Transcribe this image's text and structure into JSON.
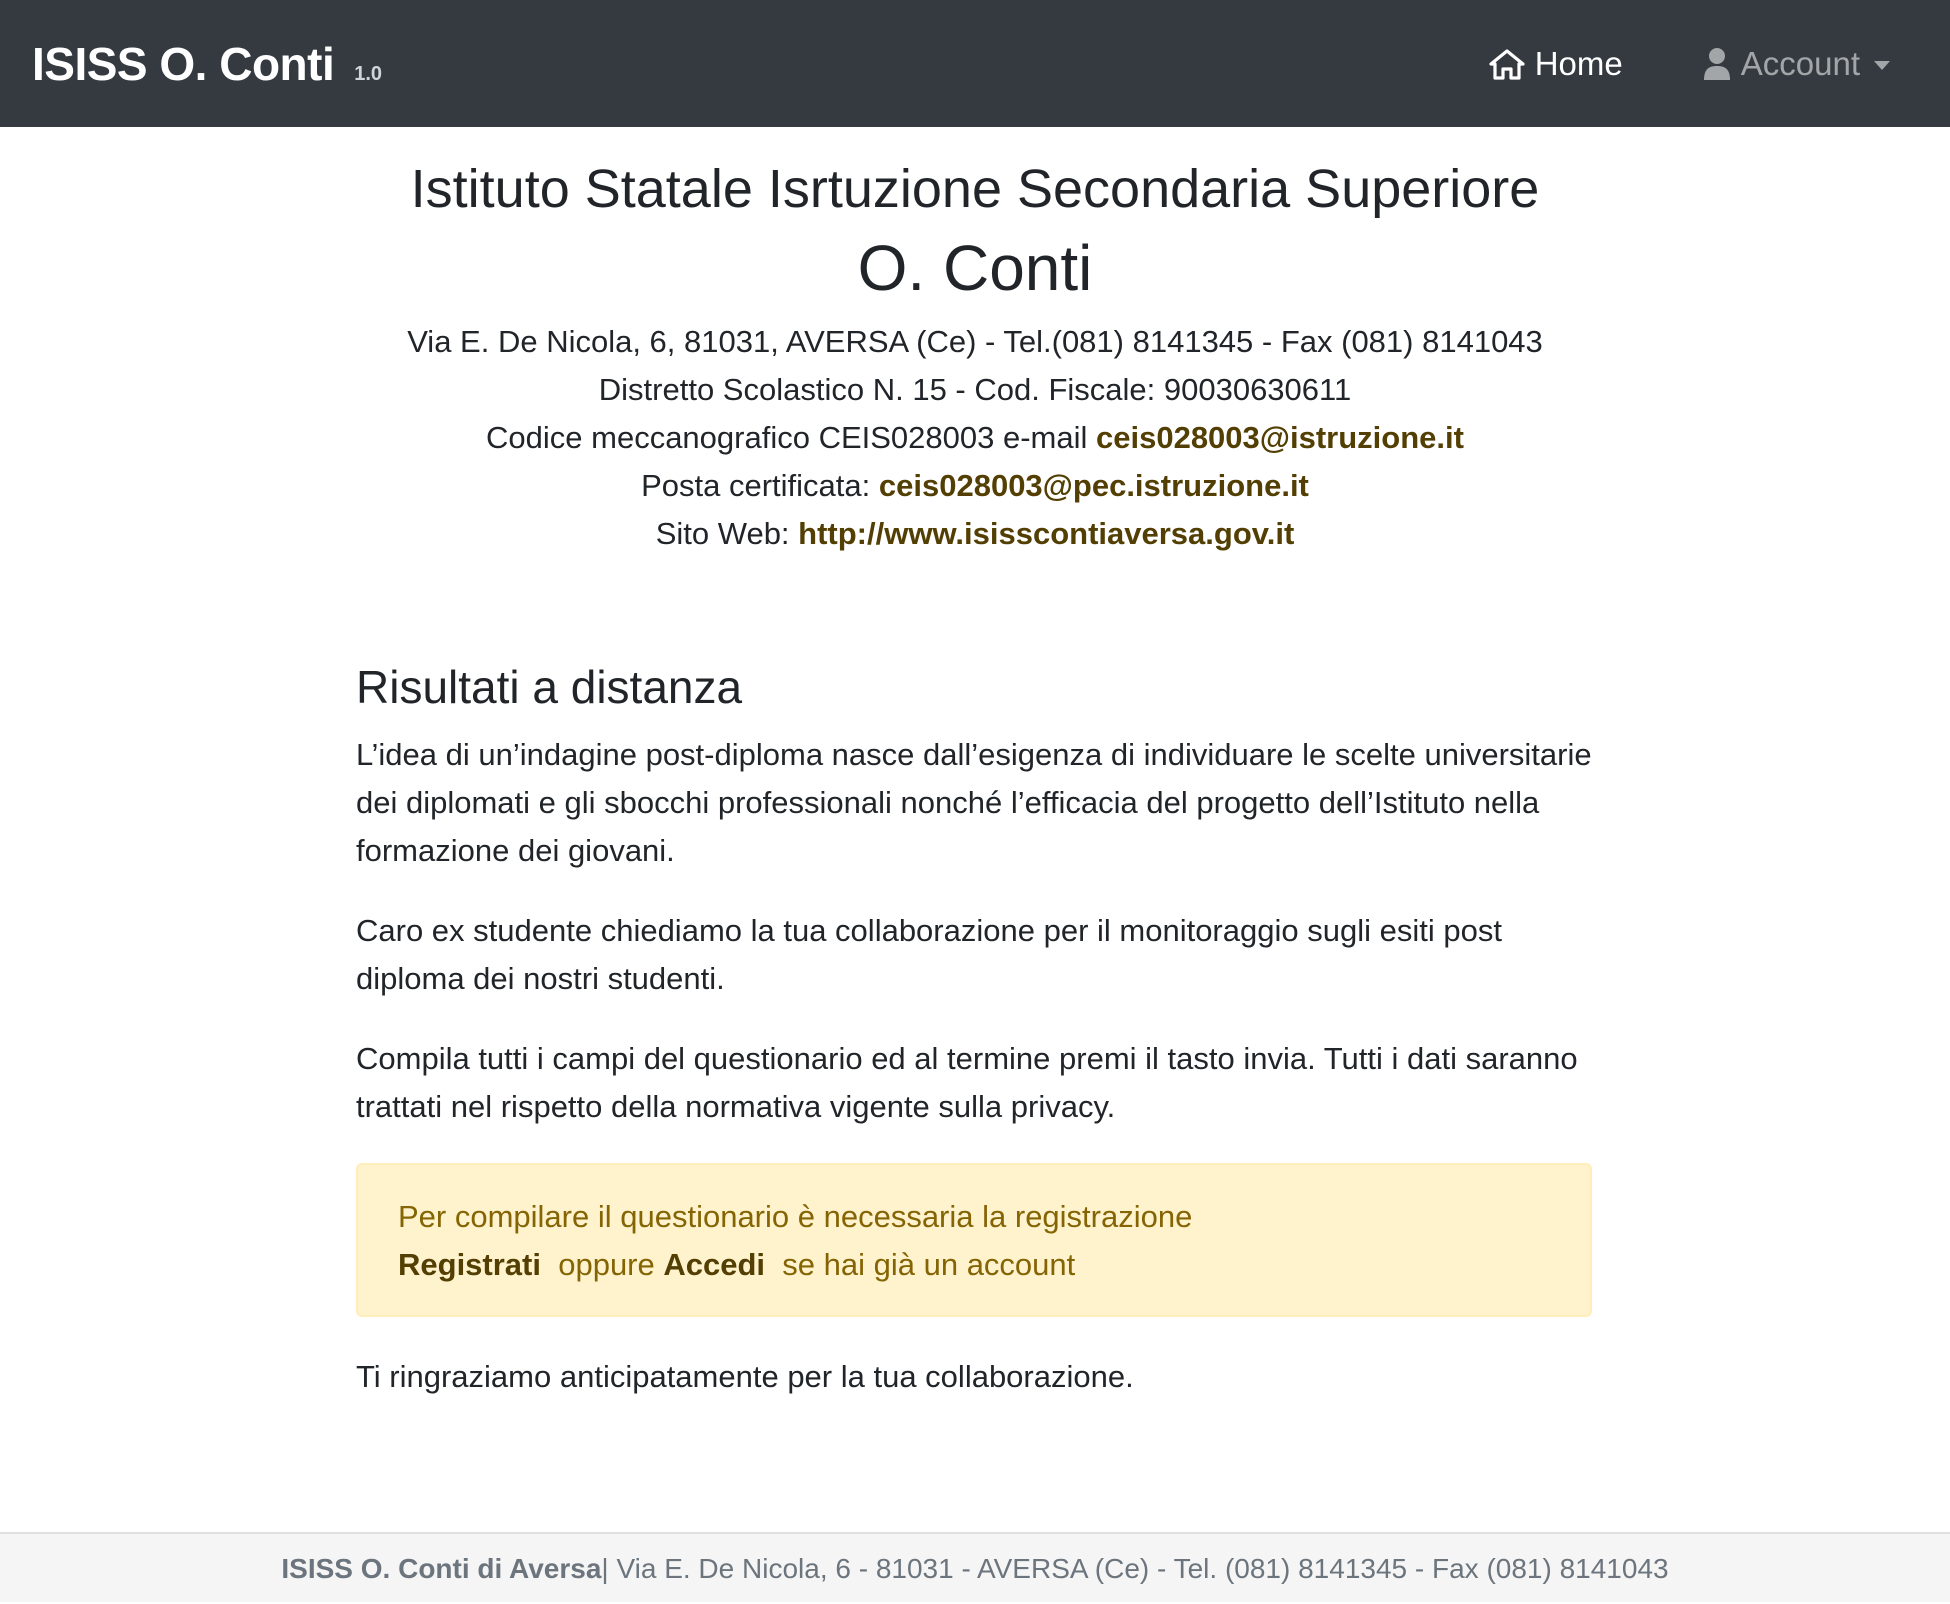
{
  "navbar": {
    "brand": "ISISS O. Conti",
    "version": "1.0",
    "home_label": "Home",
    "account_label": "Account"
  },
  "header": {
    "title": "Istituto Statale Isrtuzione Secondaria Superiore",
    "name": "O. Conti",
    "address_line": "Via E. De Nicola, 6, 81031, AVERSA (Ce) - Tel.(081) 8141345 - Fax (081) 8141043",
    "district_line": "Distretto Scolastico N. 15 - Cod. Fiscale: 90030630611",
    "code_prefix": "Codice meccanografico CEIS028003 e-mail ",
    "email": "ceis028003@istruzione.it",
    "pec_prefix": "Posta certificata: ",
    "pec": "ceis028003@pec.istruzione.it",
    "site_prefix": "Sito Web: ",
    "site": "http://www.isisscontiaversa.gov.it"
  },
  "main": {
    "section_title": "Risultati a distanza",
    "paragraphs": [
      "L’idea di un’indagine post-diploma nasce dall’esigenza di individuare le scelte universitarie dei diplomati e gli sbocchi professionali nonché l’efficacia del progetto dell’Istituto nella formazione dei giovani.",
      "Caro ex studente chiediamo la tua collaborazione per il monitoraggio sugli esiti post diploma dei nostri studenti.",
      "Compila tutti i campi del questionario ed al termine premi il tasto invia. Tutti i dati saranno trattati nel rispetto della normativa vigente sulla privacy."
    ],
    "alert": {
      "line1": "Per compilare il questionario è necessaria la registrazione",
      "register_link": "Registrati",
      "or_text": "oppure",
      "login_link": "Accedi",
      "suffix": "se hai già un account"
    },
    "thanks": "Ti ringraziamo anticipatamente per la tua collaborazione."
  },
  "footer": {
    "brand": "ISISS O. Conti di Aversa",
    "text": "| Via E. De Nicola, 6 - 81031 - AVERSA (Ce) - Tel. (081) 8141345 - Fax (081) 8141043"
  },
  "colors": {
    "navbar_bg": "#343a40",
    "alert_bg": "#fff3cd",
    "alert_text": "#856404",
    "link": "#533f03"
  }
}
